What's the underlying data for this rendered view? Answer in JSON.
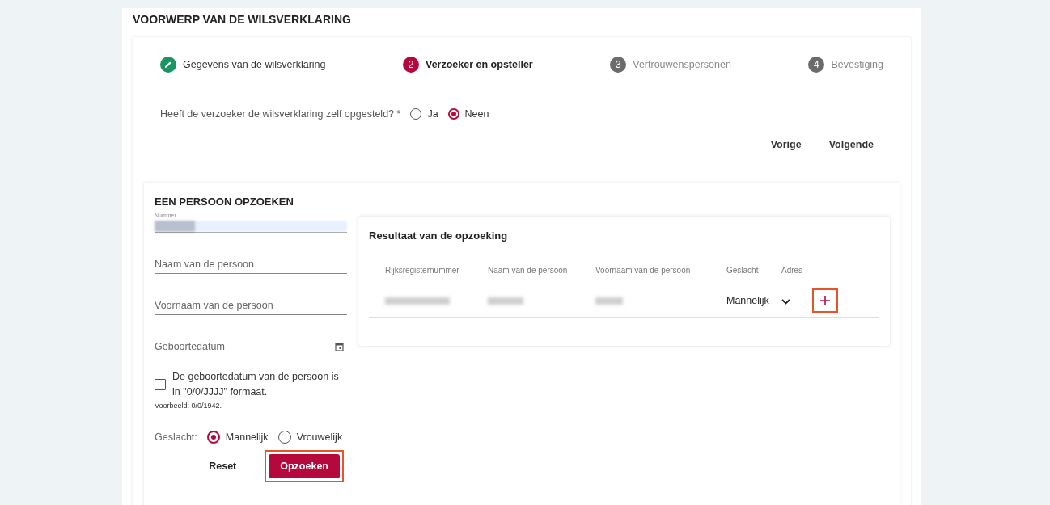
{
  "section_title": "VOORWERP VAN DE WILSVERKLARING",
  "steps": [
    {
      "kind": "done",
      "label": "Gegevens van de wilsverklaring"
    },
    {
      "kind": "active",
      "number": "2",
      "label": "Verzoeker en opsteller"
    },
    {
      "kind": "pending",
      "number": "3",
      "label": "Vertrouwenspersonen"
    },
    {
      "kind": "pending",
      "number": "4",
      "label": "Bevestiging"
    }
  ],
  "question": {
    "label": "Heeft de verzoeker de wilsverklaring zelf opgesteld? *",
    "options": [
      {
        "label": "Ja",
        "selected": false
      },
      {
        "label": "Neen",
        "selected": true
      }
    ]
  },
  "nav_buttons": [
    "Vorige",
    "Volgende"
  ],
  "search_panel": {
    "title": "EEN PERSOON OPZOEKEN",
    "fields": [
      {
        "kind": "blurred",
        "label": "Nummer"
      },
      {
        "kind": "text",
        "placeholder": "Naam van de persoon"
      },
      {
        "kind": "text",
        "placeholder": "Voornaam van de persoon"
      },
      {
        "kind": "date",
        "placeholder": "Geboortedatum"
      }
    ],
    "checkbox": {
      "label": "De geboortedatum van de persoon is in \"0/0/JJJJ\" formaat.",
      "checked": false
    },
    "example": "Voorbeeld: 0/0/1942.",
    "gender": {
      "label": "Geslacht:",
      "options": [
        {
          "label": "Mannelijk",
          "selected": true
        },
        {
          "label": "Vrouwelijk",
          "selected": false
        }
      ]
    },
    "buttons": [
      {
        "kind": "text",
        "label": "Reset",
        "highlighted": false
      },
      {
        "kind": "primary",
        "label": "Opzoeken",
        "highlighted": true
      }
    ]
  },
  "results": {
    "title": "Resultaat van de opzoeking",
    "columns": [
      "Rijksregisternummer",
      "Naam van de persoon",
      "Voornaam van de persoon",
      "Geslacht",
      "Adres"
    ],
    "rows": [
      {
        "cells": [
          {
            "kind": "blurred"
          },
          {
            "kind": "blurred"
          },
          {
            "kind": "blurred"
          },
          {
            "kind": "text",
            "text": "Mannelijk"
          }
        ],
        "expanded": false,
        "add_highlighted": true
      }
    ]
  }
}
